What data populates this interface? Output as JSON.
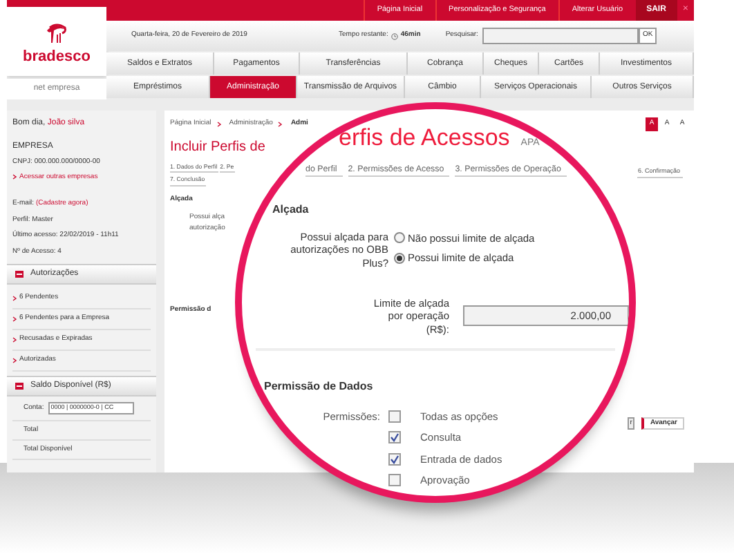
{
  "top_bar": {
    "links": [
      "Página Inicial",
      "Personalização e Segurança",
      "Alterar Usuário"
    ],
    "logout": "SAIR",
    "close": "×"
  },
  "logo": {
    "name": "bradesco",
    "subtitle": "net empresa"
  },
  "info_bar": {
    "date": "Quarta-feira, 20 de Fevereiro de 2019",
    "time_label": "Tempo restante:",
    "time_value": "46min",
    "search_label": "Pesquisar:",
    "search_button": "OK"
  },
  "menu_rows": [
    [
      {
        "label": "Saldos e Extratos",
        "selected": false
      },
      {
        "label": "Pagamentos",
        "selected": false
      },
      {
        "label": "Transferências",
        "selected": false
      },
      {
        "label": "Cobrança",
        "selected": false
      },
      {
        "label": "Cheques",
        "selected": false
      },
      {
        "label": "Cartões",
        "selected": false
      },
      {
        "label": "Investimentos",
        "selected": false
      }
    ],
    [
      {
        "label": "Empréstimos",
        "selected": false
      },
      {
        "label": "Administração",
        "selected": true
      },
      {
        "label": "Transmissão de Arquivos",
        "selected": false
      },
      {
        "label": "Câmbio",
        "selected": false
      },
      {
        "label": "Serviços Operacionais",
        "selected": false
      },
      {
        "label": "Outros Serviços",
        "selected": false
      }
    ]
  ],
  "sidebar": {
    "greeting": "Bom dia,",
    "user": "João silva",
    "company": "EMPRESA",
    "cnpj": "CNPJ: 000.000.000/0000-00",
    "switch_link": "Acessar outras empresas",
    "email_label": "E-mail:",
    "email_link": "(Cadastre agora)",
    "profile": "Perfil: Master",
    "last_access": "Último acesso: 22/02/2019 - 11h11",
    "access_count": "Nº de Acesso: 4",
    "authorizations": {
      "title": "Autorizações",
      "items": [
        "6 Pendentes",
        "6 Pendentes para a Empresa",
        "Recusadas e Expiradas",
        "Autorizadas"
      ]
    },
    "balance": {
      "title": "Saldo Disponível (R$)",
      "account_label": "Conta:",
      "account_value": "0000 | 0000000-0 | CC",
      "totals": [
        "Total",
        "Total Disponível"
      ]
    }
  },
  "content": {
    "breadcrumb": [
      "Página Inicial",
      "Administração",
      "Admi"
    ],
    "title": "Incluir Perfis de",
    "font_sizes": [
      {
        "label": "A",
        "selected": true
      },
      {
        "label": "A",
        "selected": false
      },
      {
        "label": "A",
        "selected": false
      }
    ],
    "steps": [
      "1. Dados do Perfil",
      "2. Pe",
      "7. Conclusão"
    ],
    "right_step": "6. Confirmação",
    "section_1": "Alçada",
    "question_lines": [
      "Possui alça",
      "autorização"
    ],
    "section_2": "Permissão d",
    "back_button": "r",
    "next_button": "Avançar"
  },
  "magnifier": {
    "title": "erfis de Acessos",
    "code": "APA",
    "steps": [
      "do Perfil",
      "2. Permissões de Acesso",
      "3. Permissões de Operação"
    ],
    "section_1": "Alçada",
    "question": "Possui alçada para autorizações no OBB Plus?",
    "options": [
      {
        "label": "Não possui limite de alçada",
        "selected": false
      },
      {
        "label": "Possui limite de alçada",
        "selected": true
      }
    ],
    "limit_label": "Limite de alçada por operação (R$):",
    "limit_value": "2.000,00",
    "section_2": "Permissão de Dados",
    "permissions_label": "Permissões:",
    "permissions": [
      {
        "label": "Todas as opções",
        "checked": false
      },
      {
        "label": "Consulta",
        "checked": true
      },
      {
        "label": "Entrada de dados",
        "checked": true
      },
      {
        "label": "Aprovação",
        "checked": false
      }
    ]
  }
}
